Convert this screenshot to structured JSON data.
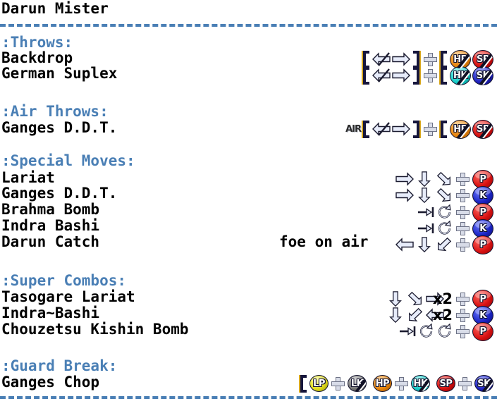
{
  "character": {
    "name": "Darun Mister"
  },
  "sections": [
    {
      "heading": ":Throws:",
      "moves": [
        {
          "name": "Backdrop",
          "note": "",
          "buttons": [
            "HP",
            "SP"
          ]
        },
        {
          "name": "German Suplex",
          "note": "",
          "buttons": [
            "HK",
            "SK"
          ]
        }
      ]
    },
    {
      "heading": ":Air Throws:",
      "moves": [
        {
          "name": "Ganges D.D.T.",
          "note": "",
          "prefix": "AIR",
          "buttons": [
            "HP",
            "SP"
          ]
        }
      ]
    },
    {
      "heading": ":Special Moves:",
      "moves": [
        {
          "name": "Lariat",
          "note": "",
          "buttons": [
            "P"
          ]
        },
        {
          "name": "Ganges D.D.T.",
          "note": "",
          "buttons": [
            "K"
          ]
        },
        {
          "name": "Brahma Bomb",
          "note": "",
          "buttons": [
            "P"
          ]
        },
        {
          "name": "Indra Bashi",
          "note": "",
          "buttons": [
            "K"
          ]
        },
        {
          "name": "Darun Catch",
          "note": "foe on air",
          "buttons": [
            "P"
          ]
        }
      ]
    },
    {
      "heading": ":Super Combos:",
      "moves": [
        {
          "name": "Tasogare Lariat",
          "note": "",
          "multiplier": "x2",
          "buttons": [
            "P"
          ]
        },
        {
          "name": "Indra~Bashi",
          "note": "",
          "multiplier": "x2",
          "buttons": [
            "K"
          ]
        },
        {
          "name": "Chouzetsu Kishin Bomb",
          "note": "",
          "buttons": [
            "P"
          ]
        }
      ]
    },
    {
      "heading": ":Guard Break:",
      "moves": [
        {
          "name": "Ganges Chop",
          "note": "",
          "buttons": [
            "LP",
            "LK",
            "HP",
            "HK",
            "SP",
            "SK"
          ]
        }
      ]
    }
  ],
  "button_labels": {
    "P": "P",
    "K": "K",
    "LP": "LP",
    "LK": "LK",
    "HP": "HP",
    "HK": "HK",
    "SP": "SP",
    "SK": "SK"
  },
  "colors": {
    "heading": "#4a7fb5",
    "text": "#000000",
    "divider": "#4a7fb5",
    "background": "#ffffff"
  }
}
